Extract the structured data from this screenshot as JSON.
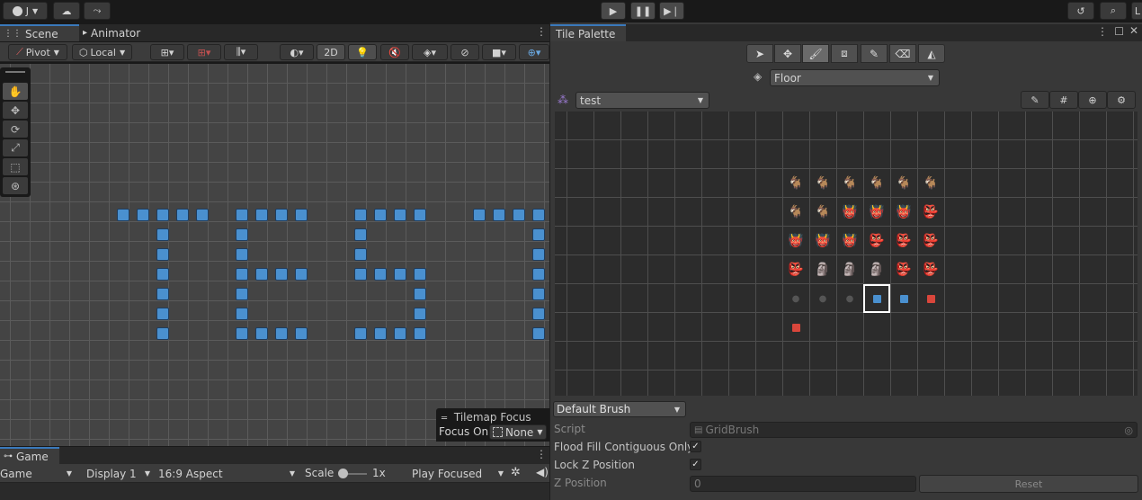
{
  "toolbar": {
    "account_label": "J",
    "layers_short": "L",
    "play_icon": "play-icon",
    "pause_icon": "pause-icon",
    "step_icon": "step-icon"
  },
  "scene_tabs": [
    {
      "label": "Scene"
    },
    {
      "label": "Animator"
    }
  ],
  "scene_toolbar": {
    "pivot_label": "Pivot",
    "local_label": "Local",
    "mode_2d_label": "2D"
  },
  "tilemap_focus": {
    "title": "Tilemap Focus",
    "focus_on_label": "Focus On",
    "focus_value": "None"
  },
  "game_panel": {
    "tab_label": "Game",
    "view_select": "Game",
    "display_select": "Display 1",
    "aspect_select": "16:9 Aspect",
    "scale_label": "Scale",
    "scale_value": "1x",
    "play_mode_select": "Play Focused"
  },
  "tile_palette": {
    "tab_label": "Tile Palette",
    "active_tilemap": "Floor",
    "palette_name": "test",
    "brush_select": "Default Brush",
    "script_label": "Script",
    "script_value": "GridBrush",
    "flood_fill_label": "Flood Fill Contiguous Only",
    "flood_fill_checked": true,
    "lock_z_label": "Lock Z Position",
    "lock_z_checked": true,
    "z_position_label": "Z Position",
    "z_position_value": "0",
    "reset_label": "Reset"
  },
  "colors": {
    "accent": "#3a79bb",
    "tile_blue": "#4a90cf",
    "tile_red": "#d9463b"
  }
}
